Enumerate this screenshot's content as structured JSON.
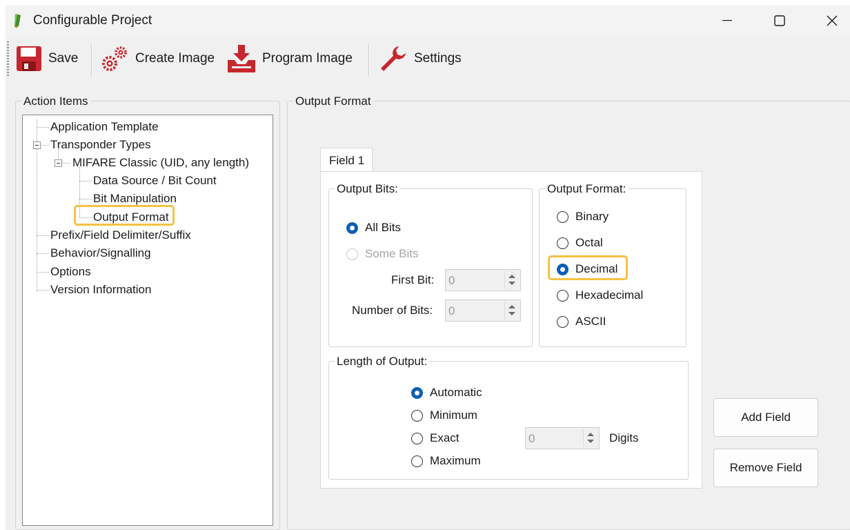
{
  "window": {
    "title": "Configurable Project"
  },
  "toolbar": {
    "save": "Save",
    "create_image": "Create Image",
    "program_image": "Program Image",
    "settings": "Settings"
  },
  "action_items": {
    "title": "Action Items",
    "items": [
      "Application Template",
      "Transponder Types",
      "MIFARE Classic (UID, any length)",
      "Data Source / Bit Count",
      "Bit Manipulation",
      "Output Format",
      "Prefix/Field Delimiter/Suffix",
      "Behavior/Signalling",
      "Options",
      "Version Information"
    ],
    "selected": "Output Format"
  },
  "output_format_panel": {
    "title": "Output Format",
    "tab": "Field 1",
    "output_bits": {
      "title": "Output Bits:",
      "all_bits": "All Bits",
      "some_bits": "Some Bits",
      "first_bit_label": "First Bit:",
      "first_bit_value": "0",
      "number_of_bits_label": "Number of Bits:",
      "number_of_bits_value": "0"
    },
    "format": {
      "title": "Output Format:",
      "options": [
        "Binary",
        "Octal",
        "Decimal",
        "Hexadecimal",
        "ASCII"
      ],
      "selected": "Decimal"
    },
    "length": {
      "title": "Length of Output:",
      "options": [
        "Automatic",
        "Minimum",
        "Exact",
        "Maximum"
      ],
      "selected": "Automatic",
      "digits_value": "0",
      "digits_label": "Digits"
    },
    "add_field": "Add Field",
    "remove_field": "Remove Field"
  },
  "colors": {
    "highlight": "#f5c242",
    "radio_checked": "#0a5fb4"
  }
}
